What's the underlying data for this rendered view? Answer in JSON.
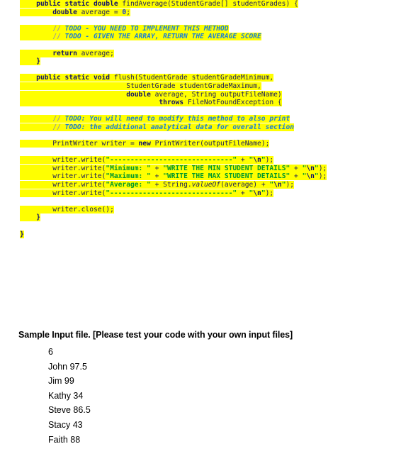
{
  "document": {
    "type": "assignment-handout-page",
    "background_color": "#ffffff",
    "highlight_color": "#ffff00",
    "syntax_colors": {
      "keyword": "#10106b",
      "plain": "#1b1b5e",
      "number": "#1a3ddb",
      "string": "#00992b",
      "comment": "#1a7fd4",
      "comment_slashes": "#9a9a9a"
    }
  },
  "code": {
    "language": "Java",
    "lines": [
      {
        "id": "line-find-average-signature",
        "highlighted": true,
        "indent": 4,
        "tokens": [
          {
            "cls": "kw",
            "t": "public static double "
          },
          {
            "cls": "plain",
            "t": "findAverage(StudentGrade[] studentGrades) {"
          }
        ]
      },
      {
        "id": "line-double-average-init",
        "highlighted": true,
        "indent": 8,
        "tokens": [
          {
            "cls": "kw",
            "t": "double "
          },
          {
            "cls": "plain",
            "t": "average = "
          },
          {
            "cls": "num",
            "t": "0"
          },
          {
            "cls": "punc",
            "t": ";"
          }
        ]
      },
      {
        "id": "line-blank-1",
        "highlighted": false,
        "indent": 0,
        "tokens": []
      },
      {
        "id": "line-todo-implement-method",
        "highlighted": true,
        "indent": 8,
        "tokens": [
          {
            "cls": "cmtslash",
            "t": "// "
          },
          {
            "cls": "cmt",
            "t": "TODO - YOU NEED TO IMPLEMENT THIS METHOD"
          }
        ]
      },
      {
        "id": "line-todo-return-average",
        "highlighted": true,
        "indent": 8,
        "tokens": [
          {
            "cls": "cmtslash",
            "t": "// "
          },
          {
            "cls": "cmt",
            "t": "TODO - GIVEN THE ARRAY, RETURN THE AVERAGE SCORE"
          }
        ]
      },
      {
        "id": "line-blank-2",
        "highlighted": false,
        "indent": 0,
        "tokens": []
      },
      {
        "id": "line-return-average",
        "highlighted": true,
        "indent": 8,
        "tokens": [
          {
            "cls": "kw",
            "t": "return "
          },
          {
            "cls": "plain",
            "t": "average;"
          }
        ]
      },
      {
        "id": "line-close-find-average",
        "highlighted": true,
        "indent": 4,
        "tokens": [
          {
            "cls": "kw",
            "t": "}"
          }
        ]
      },
      {
        "id": "line-blank-3",
        "highlighted": false,
        "indent": 0,
        "tokens": []
      },
      {
        "id": "line-flush-signature",
        "highlighted": true,
        "indent": 4,
        "tokens": [
          {
            "cls": "kw",
            "t": "public static void "
          },
          {
            "cls": "plain",
            "t": "flush(StudentGrade studentGradeMinimum,"
          }
        ]
      },
      {
        "id": "line-flush-param-maximum",
        "highlighted": true,
        "indent": 26,
        "tokens": [
          {
            "cls": "plain",
            "t": "StudentGrade studentGradeMaximum,"
          }
        ]
      },
      {
        "id": "line-flush-param-average",
        "highlighted": true,
        "indent": 26,
        "tokens": [
          {
            "cls": "kw",
            "t": "double "
          },
          {
            "cls": "plain",
            "t": "average, String outputFileName)"
          }
        ]
      },
      {
        "id": "line-flush-throws",
        "highlighted": true,
        "indent": 34,
        "tokens": [
          {
            "cls": "kw",
            "t": "throws "
          },
          {
            "cls": "plain",
            "t": "FileNotFoundException {"
          }
        ]
      },
      {
        "id": "line-blank-4",
        "highlighted": false,
        "indent": 0,
        "tokens": []
      },
      {
        "id": "line-todo-modify-method",
        "highlighted": true,
        "indent": 8,
        "tokens": [
          {
            "cls": "cmtslash",
            "t": "// "
          },
          {
            "cls": "cmt",
            "t": "TODO: You will need to modify this method to also print"
          }
        ]
      },
      {
        "id": "line-todo-analytical-data",
        "highlighted": true,
        "indent": 8,
        "tokens": [
          {
            "cls": "cmtslash",
            "t": "// "
          },
          {
            "cls": "cmt",
            "t": "TODO: the additional analytical data for overall section"
          }
        ]
      },
      {
        "id": "line-blank-5",
        "highlighted": false,
        "indent": 0,
        "tokens": []
      },
      {
        "id": "line-printwriter-new",
        "highlighted": true,
        "indent": 8,
        "tokens": [
          {
            "cls": "plain",
            "t": "PrintWriter writer = "
          },
          {
            "cls": "kw",
            "t": "new "
          },
          {
            "cls": "plain",
            "t": "PrintWriter(outputFileName);"
          }
        ]
      },
      {
        "id": "line-blank-6",
        "highlighted": false,
        "indent": 0,
        "tokens": []
      },
      {
        "id": "line-write-separator-top",
        "highlighted": true,
        "indent": 8,
        "tokens": [
          {
            "cls": "plain",
            "t": "writer.write("
          },
          {
            "cls": "str",
            "t": "\"------------------------------\""
          },
          {
            "cls": "plain",
            "t": " + "
          },
          {
            "cls": "str",
            "t": "\""
          },
          {
            "cls": "esc",
            "t": "\\n"
          },
          {
            "cls": "str",
            "t": "\""
          },
          {
            "cls": "plain",
            "t": ");"
          }
        ]
      },
      {
        "id": "line-write-minimum",
        "highlighted": true,
        "indent": 8,
        "tokens": [
          {
            "cls": "plain",
            "t": "writer.write("
          },
          {
            "cls": "str",
            "t": "\"Minimum: \""
          },
          {
            "cls": "plain",
            "t": " + "
          },
          {
            "cls": "str",
            "t": "\"WRITE THE MIN STUDENT DETAILS\""
          },
          {
            "cls": "plain",
            "t": " + "
          },
          {
            "cls": "str",
            "t": "\""
          },
          {
            "cls": "esc",
            "t": "\\n"
          },
          {
            "cls": "str",
            "t": "\""
          },
          {
            "cls": "plain",
            "t": ");"
          }
        ]
      },
      {
        "id": "line-write-maximum",
        "highlighted": true,
        "indent": 8,
        "tokens": [
          {
            "cls": "plain",
            "t": "writer.write("
          },
          {
            "cls": "str",
            "t": "\"Maximum: \""
          },
          {
            "cls": "plain",
            "t": " + "
          },
          {
            "cls": "str",
            "t": "\"WRITE THE MAX STUDENT DETAILS\""
          },
          {
            "cls": "plain",
            "t": " + "
          },
          {
            "cls": "str",
            "t": "\""
          },
          {
            "cls": "esc",
            "t": "\\n"
          },
          {
            "cls": "str",
            "t": "\""
          },
          {
            "cls": "plain",
            "t": ");"
          }
        ]
      },
      {
        "id": "line-write-average",
        "highlighted": true,
        "indent": 8,
        "tokens": [
          {
            "cls": "plain",
            "t": "writer.write("
          },
          {
            "cls": "str",
            "t": "\"Average: \""
          },
          {
            "cls": "plain",
            "t": " + String."
          },
          {
            "cls": "plain ital",
            "t": "valueOf"
          },
          {
            "cls": "plain",
            "t": "(average) + "
          },
          {
            "cls": "str",
            "t": "\""
          },
          {
            "cls": "esc",
            "t": "\\n"
          },
          {
            "cls": "str",
            "t": "\""
          },
          {
            "cls": "plain",
            "t": ");"
          }
        ]
      },
      {
        "id": "line-write-separator-bottom",
        "highlighted": true,
        "indent": 8,
        "tokens": [
          {
            "cls": "plain",
            "t": "writer.write("
          },
          {
            "cls": "str",
            "t": "\"------------------------------\""
          },
          {
            "cls": "plain",
            "t": " + "
          },
          {
            "cls": "str",
            "t": "\""
          },
          {
            "cls": "esc",
            "t": "\\n"
          },
          {
            "cls": "str",
            "t": "\""
          },
          {
            "cls": "plain",
            "t": ");"
          }
        ]
      },
      {
        "id": "line-blank-7",
        "highlighted": false,
        "indent": 0,
        "tokens": []
      },
      {
        "id": "line-writer-close",
        "highlighted": true,
        "indent": 8,
        "tokens": [
          {
            "cls": "plain",
            "t": "writer.close();"
          }
        ]
      },
      {
        "id": "line-close-flush",
        "highlighted": true,
        "indent": 4,
        "tokens": [
          {
            "cls": "kw",
            "t": "}"
          }
        ]
      },
      {
        "id": "line-blank-8",
        "highlighted": false,
        "indent": 0,
        "tokens": []
      },
      {
        "id": "line-close-class",
        "highlighted": true,
        "indent": 0,
        "tokens": [
          {
            "cls": "kw",
            "t": "}"
          }
        ]
      }
    ]
  },
  "sample_input": {
    "heading": "Sample Input file. [Please test your code with your own input files]",
    "lines": [
      "6",
      "John 97.5",
      "Jim 99",
      "Kathy 34",
      "Steve 86.5",
      "Stacy 43",
      "Faith 88"
    ]
  }
}
